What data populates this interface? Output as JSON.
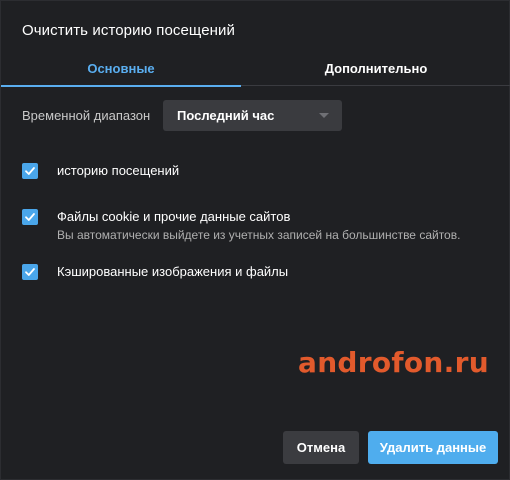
{
  "dialog": {
    "title": "Очистить историю посещений"
  },
  "tabs": [
    {
      "label": "Основные",
      "active": true
    },
    {
      "label": "Дополнительно",
      "active": false
    }
  ],
  "time_range": {
    "label": "Временной диапазон",
    "selected": "Последний час"
  },
  "options": [
    {
      "label": "историю посещений",
      "checked": true,
      "description": ""
    },
    {
      "label": "Файлы cookie и прочие данные сайтов",
      "checked": true,
      "description": "Вы автоматически выйдете из учетных записей на большинстве сайтов."
    },
    {
      "label": "Кэшированные изображения и файлы",
      "checked": true,
      "description": ""
    }
  ],
  "watermark": "androfon.ru",
  "buttons": {
    "cancel": "Отмена",
    "delete": "Удалить данные"
  },
  "colors": {
    "background": "#1f2023",
    "accent": "#4fadee",
    "watermark": "#e25a2c"
  }
}
